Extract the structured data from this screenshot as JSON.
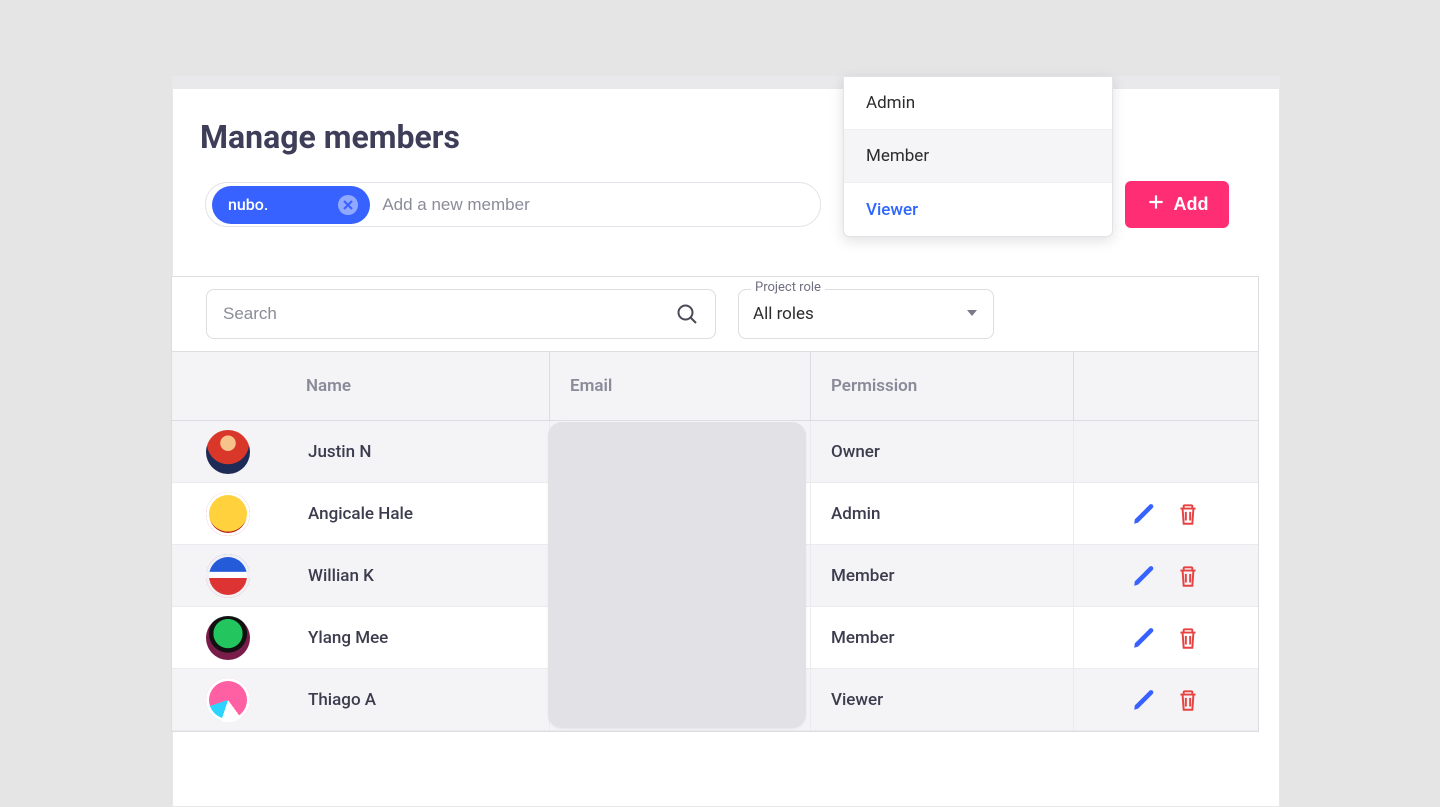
{
  "title": "Manage members",
  "add": {
    "chip": "nubo.",
    "placeholder": "Add a new member",
    "button": "Add"
  },
  "role_dropdown": {
    "options": [
      "Admin",
      "Member",
      "Viewer"
    ],
    "hovered_index": 1,
    "selected_index": 2
  },
  "filters": {
    "search_placeholder": "Search",
    "role_label": "Project role",
    "role_value": "All roles"
  },
  "columns": {
    "name": "Name",
    "email": "Email",
    "permission": "Permission"
  },
  "members": [
    {
      "name": "Justin N",
      "permission": "Owner",
      "owner": true
    },
    {
      "name": "Angicale Hale",
      "permission": "Admin",
      "owner": false
    },
    {
      "name": "Willian K",
      "permission": "Member",
      "owner": false
    },
    {
      "name": "Ylang Mee",
      "permission": "Member",
      "owner": false
    },
    {
      "name": "Thiago A",
      "permission": "Viewer",
      "owner": false
    }
  ],
  "colors": {
    "accent": "#3862ff",
    "primary": "#ff2d74",
    "danger": "#e74141"
  }
}
